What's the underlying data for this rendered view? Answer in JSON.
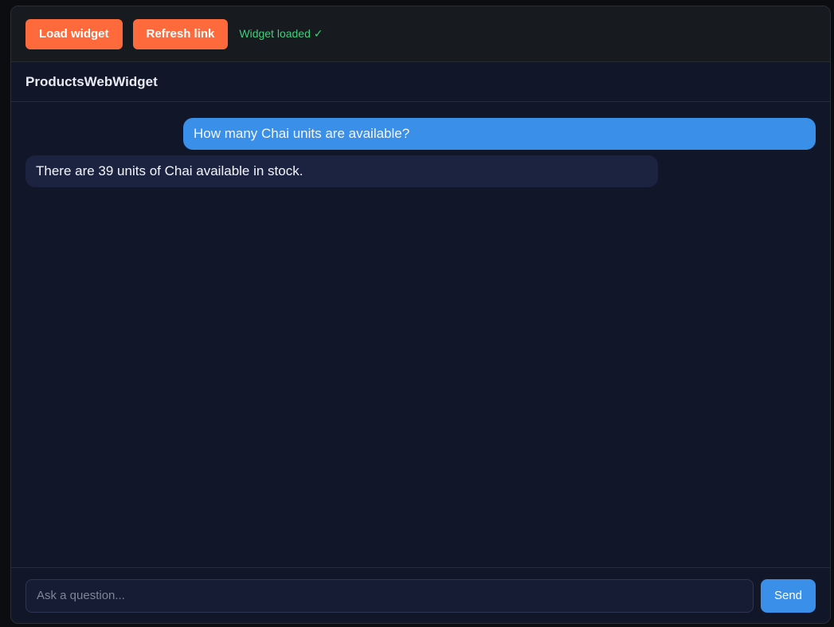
{
  "toolbar": {
    "load_label": "Load widget",
    "refresh_label": "Refresh link",
    "status_text": "Widget loaded ✓"
  },
  "widget": {
    "title": "ProductsWebWidget"
  },
  "messages": [
    {
      "role": "user",
      "text": "How many Chai units are available?"
    },
    {
      "role": "assistant",
      "text": "There are 39 units of Chai available in stock."
    }
  ],
  "composer": {
    "value": "",
    "placeholder": "Ask a question...",
    "send_label": "Send"
  },
  "colors": {
    "accent_orange": "#ff6a3d",
    "accent_blue": "#3a8fe8",
    "status_green": "#3ecf7a",
    "panel_bg": "#111628"
  }
}
